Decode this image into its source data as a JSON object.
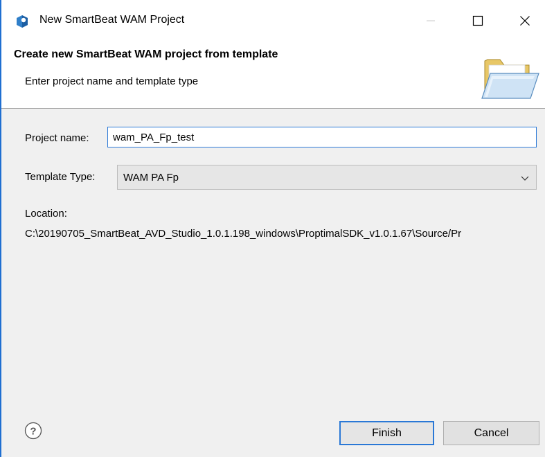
{
  "window": {
    "title": "New SmartBeat WAM Project",
    "accent_color": "#1f6fd1"
  },
  "banner": {
    "title": "Create new SmartBeat WAM project from template",
    "subtitle": "Enter project name and template type",
    "icon": "folder-open-icon"
  },
  "form": {
    "project_name_label": "Project name:",
    "project_name_value": "wam_PA_Fp_test",
    "template_type_label": "Template Type:",
    "template_type_value": "WAM PA Fp",
    "location_label": "Location:",
    "location_value": "C:\\20190705_SmartBeat_AVD_Studio_1.0.1.198_windows\\ProptimalSDK_v1.0.1.67\\Source/Pr"
  },
  "buttons": {
    "finish": "Finish",
    "cancel": "Cancel",
    "help_icon": "help-icon"
  }
}
